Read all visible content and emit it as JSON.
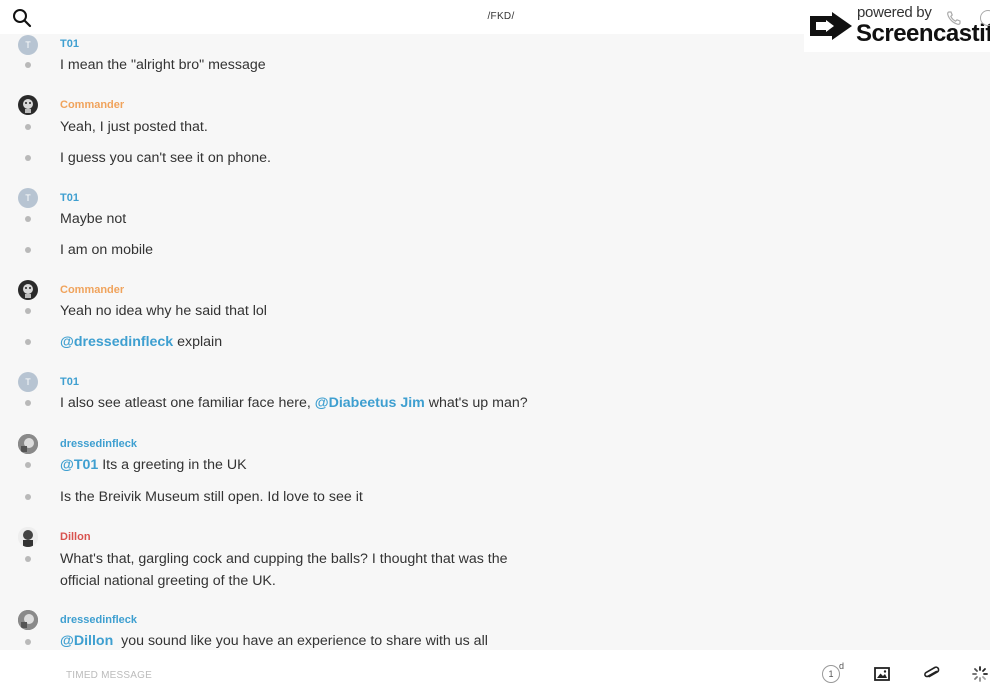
{
  "header": {
    "channel_title": "/FKD/"
  },
  "watermark": {
    "powered_by": "powered by",
    "brand": "Screencastify"
  },
  "messages": [
    {
      "author": "T01",
      "avatar_letter": "T",
      "lines": [
        {
          "text": "I mean the \"alright bro\" message"
        }
      ]
    },
    {
      "author": "Commander",
      "lines": [
        {
          "text": "Yeah, I just posted that."
        },
        {
          "text": "I guess you can't see it on phone."
        }
      ]
    },
    {
      "author": "T01",
      "avatar_letter": "T",
      "lines": [
        {
          "text": "Maybe not"
        },
        {
          "text": "I am on mobile"
        }
      ]
    },
    {
      "author": "Commander",
      "lines": [
        {
          "text": "Yeah no idea why he said that lol"
        },
        {
          "mention": "@dressedinfleck",
          "text": " explain"
        }
      ]
    },
    {
      "author": "T01",
      "avatar_letter": "T",
      "lines": [
        {
          "prefix": "I also see atleast one familiar face here, ",
          "mention": "@Diabeetus Jim",
          "text": " what's up man?"
        }
      ]
    },
    {
      "author": "dressedinfleck",
      "lines": [
        {
          "mention": "@T01",
          "text": " Its a greeting in the UK"
        },
        {
          "text": "Is the Breivik Museum still open. Id love to see it"
        }
      ]
    },
    {
      "author": "Dillon",
      "lines": [
        {
          "text": "What's that, gargling cock and cupping the balls? I thought that was the"
        },
        {
          "text": "official national greeting of the UK."
        }
      ]
    },
    {
      "author": "dressedinfleck",
      "lines": [
        {
          "mention": "@Dillon",
          "text": "  you sound like you have an experience to share with us all"
        }
      ]
    }
  ],
  "composer": {
    "placeholder": "TIMED MESSAGE",
    "timer_value": "1",
    "timer_unit": "d"
  },
  "colors": {
    "mention": "#3e9fd0",
    "author_T01": "#3e9fd0",
    "author_Commander": "#f0a35c",
    "author_dressedinfleck": "#3e9fd0",
    "author_Dillon": "#d9534f"
  },
  "icons": {
    "search": "search-icon",
    "image": "image-icon",
    "attach": "paperclip-icon",
    "loading": "spinner-icon",
    "phone": "phone-icon",
    "info": "info-icon"
  }
}
